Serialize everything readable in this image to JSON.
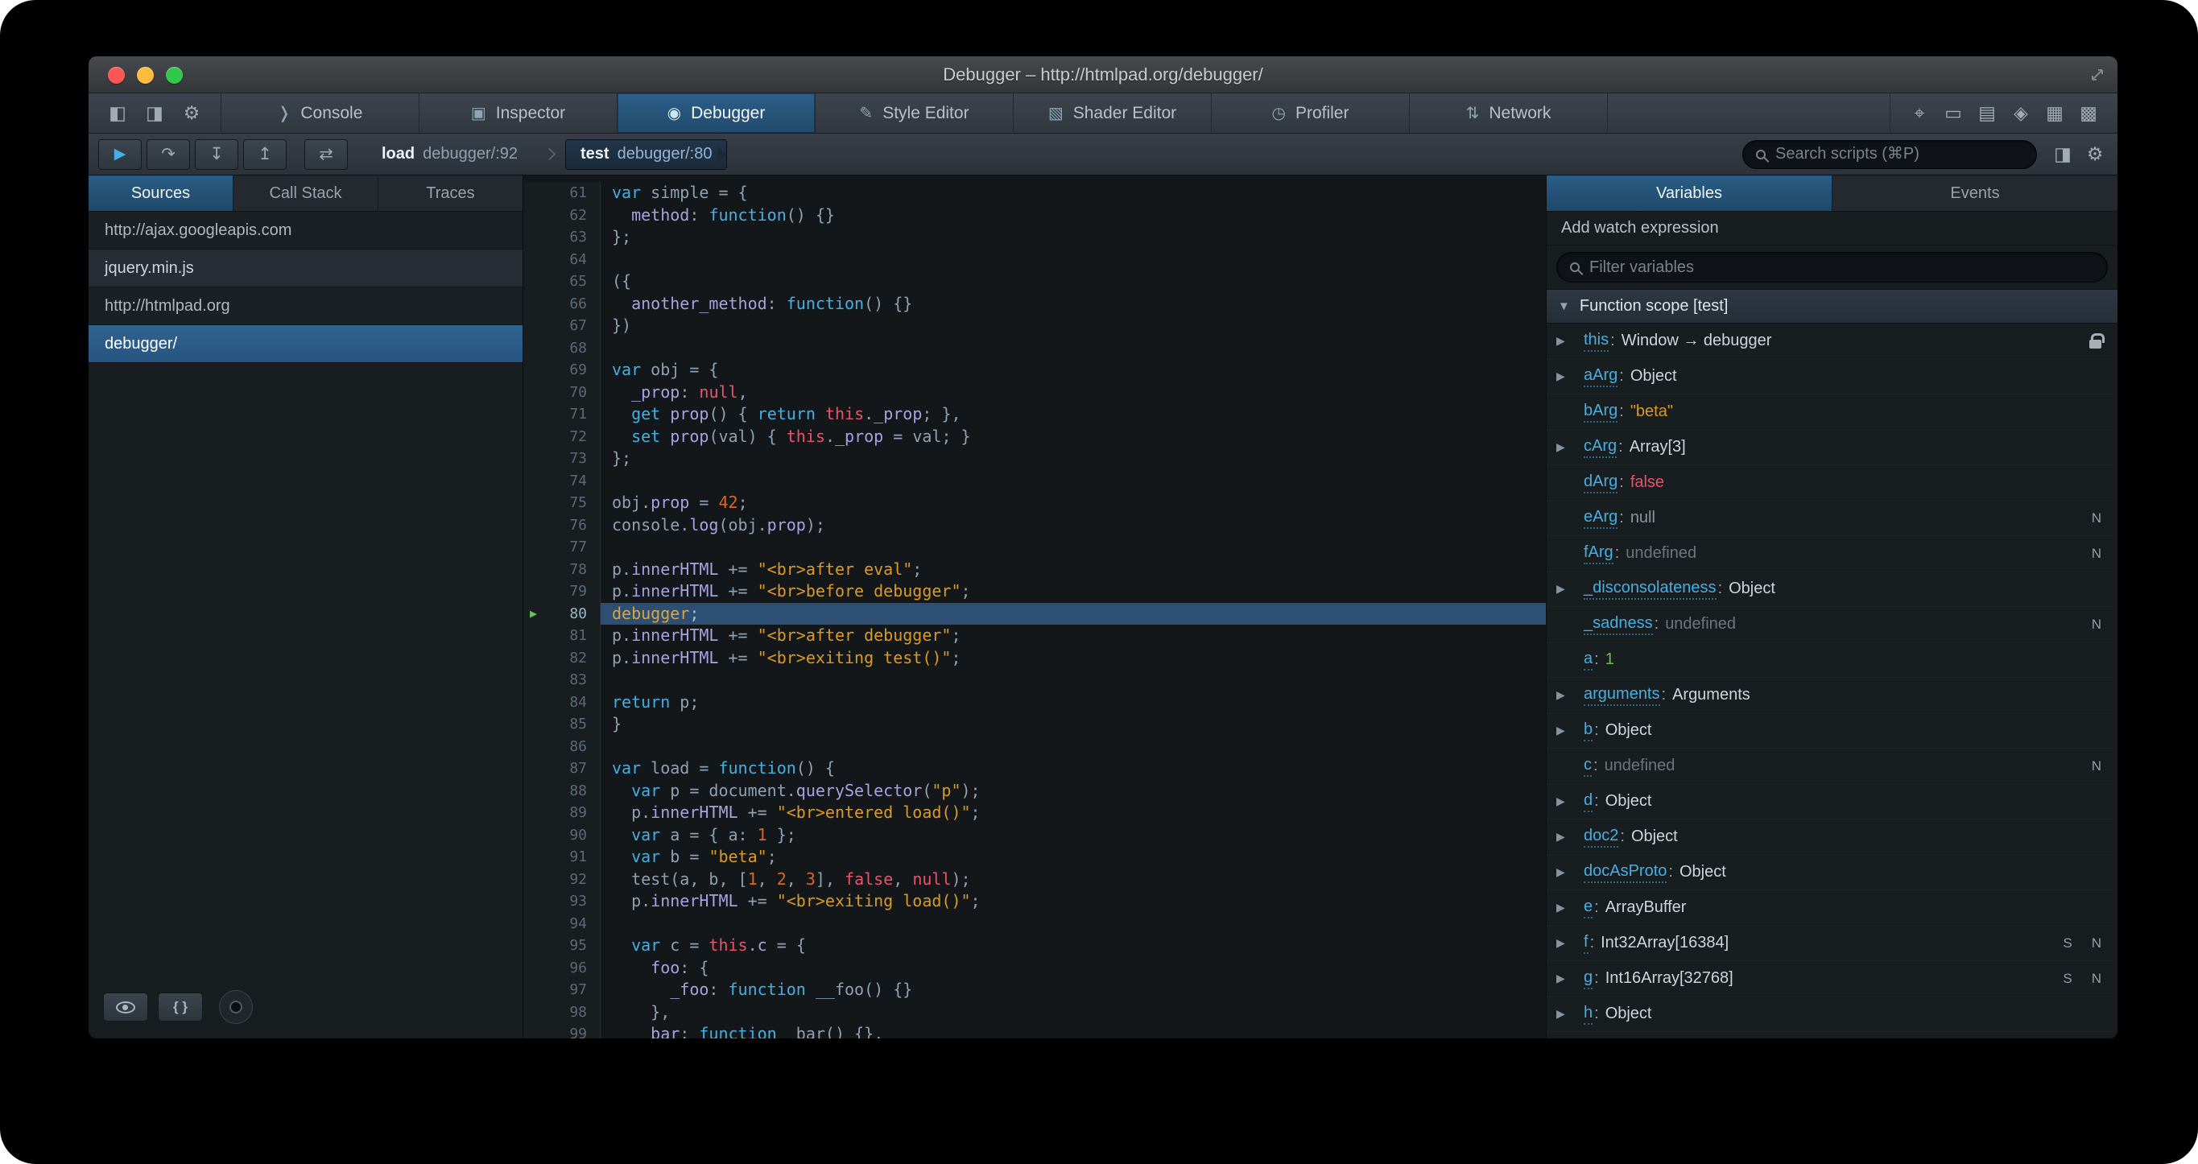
{
  "window": {
    "title": "Debugger – http://htmlpad.org/debugger/"
  },
  "theme": {
    "accent_blue": "#46afe3",
    "selection_blue": "#2d4f74",
    "string_orange": "#d99b28",
    "atom_red": "#eb5368",
    "number_orange": "#d96629",
    "green": "#70bf53",
    "panel_bg": "#181d20"
  },
  "titlebar": {
    "traffic_lights": [
      {
        "name": "close-button",
        "color": "#fc5753"
      },
      {
        "name": "minimize-button",
        "color": "#fdbc40"
      },
      {
        "name": "zoom-button",
        "color": "#34c84a"
      }
    ]
  },
  "toolbar": {
    "left_icons": [
      {
        "name": "dock-mode-icon",
        "glyph": "◧"
      },
      {
        "name": "toggle-split-icon",
        "glyph": "◨"
      },
      {
        "name": "devtools-options-gear-icon",
        "glyph": "⚙"
      }
    ],
    "tabs": [
      {
        "label": "Console",
        "icon": "console-icon",
        "glyph": "❭",
        "active": false
      },
      {
        "label": "Inspector",
        "icon": "inspector-icon",
        "glyph": "▣",
        "active": false
      },
      {
        "label": "Debugger",
        "icon": "debugger-icon",
        "glyph": "◉",
        "active": true
      },
      {
        "label": "Style Editor",
        "icon": "style-editor-icon",
        "glyph": "✎",
        "active": false
      },
      {
        "label": "Shader Editor",
        "icon": "shader-editor-icon",
        "glyph": "▧",
        "active": false
      },
      {
        "label": "Profiler",
        "icon": "profiler-icon",
        "glyph": "◷",
        "active": false
      },
      {
        "label": "Network",
        "icon": "network-icon",
        "glyph": "⇅",
        "active": false
      }
    ],
    "right_icons": [
      {
        "name": "pick-element-icon",
        "glyph": "⌖"
      },
      {
        "name": "split-console-icon",
        "glyph": "▭"
      },
      {
        "name": "responsive-mode-icon",
        "glyph": "▤"
      },
      {
        "name": "paintbrush-icon",
        "glyph": "◈"
      },
      {
        "name": "scratchpad-icon",
        "glyph": "▦"
      },
      {
        "name": "tilt-3d-icon",
        "glyph": "▩"
      }
    ]
  },
  "debug_toolbar": {
    "buttons": [
      {
        "name": "resume-button",
        "glyph": "▶",
        "accent": true
      },
      {
        "name": "step-over-button",
        "glyph": "↷"
      },
      {
        "name": "step-in-button",
        "glyph": "↧"
      },
      {
        "name": "step-out-button",
        "glyph": "↥"
      },
      {
        "name": "pause-on-exceptions-button",
        "glyph": "⇄",
        "gap": true
      }
    ],
    "breadcrumbs": [
      {
        "fn": "load",
        "loc": "debugger/:92",
        "active": false
      },
      {
        "fn": "test",
        "loc": "debugger/:80",
        "active": true
      }
    ],
    "search_placeholder": "Search scripts (⌘P)",
    "right_icons": [
      {
        "name": "toggle-panes-icon",
        "glyph": "◨"
      },
      {
        "name": "debugger-settings-gear-icon",
        "glyph": "⚙"
      }
    ]
  },
  "sources": {
    "tabs": [
      "Sources",
      "Call Stack",
      "Traces"
    ],
    "active_tab": "Sources",
    "items": [
      {
        "label": "http://ajax.googleapis.com",
        "kind": "host",
        "selected": false
      },
      {
        "label": "jquery.min.js",
        "kind": "file",
        "selected": false
      },
      {
        "label": "http://htmlpad.org",
        "kind": "host",
        "selected": false
      },
      {
        "label": "debugger/",
        "kind": "file",
        "selected": true
      }
    ],
    "prettify_glyph": "{ }"
  },
  "editor": {
    "lines": [
      {
        "n": 61,
        "t": [
          [
            "kw",
            "var"
          ],
          [
            "pln",
            " simple = {"
          ]
        ]
      },
      {
        "n": 62,
        "t": [
          [
            "pln",
            "  "
          ],
          [
            "prop",
            "method"
          ],
          [
            "pln",
            ": "
          ],
          [
            "kw",
            "function"
          ],
          [
            "pln",
            "() {}"
          ]
        ]
      },
      {
        "n": 63,
        "t": [
          [
            "pln",
            "};"
          ]
        ]
      },
      {
        "n": 64,
        "t": []
      },
      {
        "n": 65,
        "t": [
          [
            "pln",
            "({"
          ]
        ]
      },
      {
        "n": 66,
        "t": [
          [
            "pln",
            "  "
          ],
          [
            "prop",
            "another_method"
          ],
          [
            "pln",
            ": "
          ],
          [
            "kw",
            "function"
          ],
          [
            "pln",
            "() {}"
          ]
        ]
      },
      {
        "n": 67,
        "t": [
          [
            "pln",
            "})"
          ]
        ]
      },
      {
        "n": 68,
        "t": []
      },
      {
        "n": 69,
        "t": [
          [
            "kw",
            "var"
          ],
          [
            "pln",
            " obj = {"
          ]
        ]
      },
      {
        "n": 70,
        "t": [
          [
            "pln",
            "  "
          ],
          [
            "prop",
            "_prop"
          ],
          [
            "pln",
            ": "
          ],
          [
            "atom",
            "null"
          ],
          [
            "pln",
            ","
          ]
        ]
      },
      {
        "n": 71,
        "t": [
          [
            "pln",
            "  "
          ],
          [
            "kw",
            "get"
          ],
          [
            "pln",
            " "
          ],
          [
            "prop",
            "prop"
          ],
          [
            "pln",
            "() { "
          ],
          [
            "kw",
            "return"
          ],
          [
            "pln",
            " "
          ],
          [
            "ths",
            "this"
          ],
          [
            "pln",
            "."
          ],
          [
            "prop",
            "_prop"
          ],
          [
            "pln",
            "; },"
          ]
        ]
      },
      {
        "n": 72,
        "t": [
          [
            "pln",
            "  "
          ],
          [
            "kw",
            "set"
          ],
          [
            "pln",
            " "
          ],
          [
            "prop",
            "prop"
          ],
          [
            "pln",
            "(val) { "
          ],
          [
            "ths",
            "this"
          ],
          [
            "pln",
            "."
          ],
          [
            "prop",
            "_prop"
          ],
          [
            "pln",
            " = val; }"
          ]
        ]
      },
      {
        "n": 73,
        "t": [
          [
            "pln",
            "};"
          ]
        ]
      },
      {
        "n": 74,
        "t": []
      },
      {
        "n": 75,
        "t": [
          [
            "pln",
            "obj."
          ],
          [
            "prop",
            "prop"
          ],
          [
            "pln",
            " = "
          ],
          [
            "num",
            "42"
          ],
          [
            "pln",
            ";"
          ]
        ]
      },
      {
        "n": 76,
        "t": [
          [
            "pln",
            "console."
          ],
          [
            "prop",
            "log"
          ],
          [
            "pln",
            "(obj."
          ],
          [
            "prop",
            "prop"
          ],
          [
            "pln",
            ");"
          ]
        ]
      },
      {
        "n": 77,
        "t": []
      },
      {
        "n": 78,
        "t": [
          [
            "pln",
            "p."
          ],
          [
            "prop",
            "innerHTML"
          ],
          [
            "pln",
            " += "
          ],
          [
            "str",
            "\"<br>after eval\""
          ],
          [
            "pln",
            ";"
          ]
        ]
      },
      {
        "n": 79,
        "t": [
          [
            "pln",
            "p."
          ],
          [
            "prop",
            "innerHTML"
          ],
          [
            "pln",
            " += "
          ],
          [
            "str",
            "\"<br>before debugger\""
          ],
          [
            "pln",
            ";"
          ]
        ]
      },
      {
        "n": 80,
        "hl": true,
        "t": [
          [
            "dbg",
            "debugger"
          ],
          [
            "pln",
            ";"
          ]
        ]
      },
      {
        "n": 81,
        "t": [
          [
            "pln",
            "p."
          ],
          [
            "prop",
            "innerHTML"
          ],
          [
            "pln",
            " += "
          ],
          [
            "str",
            "\"<br>after debugger\""
          ],
          [
            "pln",
            ";"
          ]
        ]
      },
      {
        "n": 82,
        "t": [
          [
            "pln",
            "p."
          ],
          [
            "prop",
            "innerHTML"
          ],
          [
            "pln",
            " += "
          ],
          [
            "str",
            "\"<br>exiting test()\""
          ],
          [
            "pln",
            ";"
          ]
        ]
      },
      {
        "n": 83,
        "t": []
      },
      {
        "n": 84,
        "t": [
          [
            "kw",
            "return"
          ],
          [
            "pln",
            " p;"
          ]
        ]
      },
      {
        "n": 85,
        "t": [
          [
            "pln",
            "}"
          ]
        ]
      },
      {
        "n": 86,
        "t": []
      },
      {
        "n": 87,
        "t": [
          [
            "kw",
            "var"
          ],
          [
            "pln",
            " load = "
          ],
          [
            "kw",
            "function"
          ],
          [
            "pln",
            "() {"
          ]
        ]
      },
      {
        "n": 88,
        "t": [
          [
            "pln",
            "  "
          ],
          [
            "kw",
            "var"
          ],
          [
            "pln",
            " p = document."
          ],
          [
            "prop",
            "querySelector"
          ],
          [
            "pln",
            "("
          ],
          [
            "str",
            "\"p\""
          ],
          [
            "pln",
            ");"
          ]
        ]
      },
      {
        "n": 89,
        "t": [
          [
            "pln",
            "  p."
          ],
          [
            "prop",
            "innerHTML"
          ],
          [
            "pln",
            " += "
          ],
          [
            "str",
            "\"<br>entered load()\""
          ],
          [
            "pln",
            ";"
          ]
        ]
      },
      {
        "n": 90,
        "t": [
          [
            "pln",
            "  "
          ],
          [
            "kw",
            "var"
          ],
          [
            "pln",
            " a = { a: "
          ],
          [
            "num",
            "1"
          ],
          [
            "pln",
            " };"
          ]
        ]
      },
      {
        "n": 91,
        "t": [
          [
            "pln",
            "  "
          ],
          [
            "kw",
            "var"
          ],
          [
            "pln",
            " b = "
          ],
          [
            "str",
            "\"beta\""
          ],
          [
            "pln",
            ";"
          ]
        ]
      },
      {
        "n": 92,
        "t": [
          [
            "pln",
            "  test(a, b, ["
          ],
          [
            "num",
            "1"
          ],
          [
            "pln",
            ", "
          ],
          [
            "num",
            "2"
          ],
          [
            "pln",
            ", "
          ],
          [
            "num",
            "3"
          ],
          [
            "pln",
            "], "
          ],
          [
            "atom",
            "false"
          ],
          [
            "pln",
            ", "
          ],
          [
            "atom",
            "null"
          ],
          [
            "pln",
            ");"
          ]
        ]
      },
      {
        "n": 93,
        "t": [
          [
            "pln",
            "  p."
          ],
          [
            "prop",
            "innerHTML"
          ],
          [
            "pln",
            " += "
          ],
          [
            "str",
            "\"<br>exiting load()\""
          ],
          [
            "pln",
            ";"
          ]
        ]
      },
      {
        "n": 94,
        "t": []
      },
      {
        "n": 95,
        "t": [
          [
            "pln",
            "  "
          ],
          [
            "kw",
            "var"
          ],
          [
            "pln",
            " c = "
          ],
          [
            "ths",
            "this"
          ],
          [
            "pln",
            "."
          ],
          [
            "prop",
            "c"
          ],
          [
            "pln",
            " = {"
          ]
        ]
      },
      {
        "n": 96,
        "t": [
          [
            "pln",
            "    "
          ],
          [
            "prop",
            "foo"
          ],
          [
            "pln",
            ": {"
          ]
        ]
      },
      {
        "n": 97,
        "t": [
          [
            "pln",
            "      "
          ],
          [
            "prop",
            "_foo"
          ],
          [
            "pln",
            ": "
          ],
          [
            "kw",
            "function"
          ],
          [
            "pln",
            " __foo() {}"
          ]
        ]
      },
      {
        "n": 98,
        "t": [
          [
            "pln",
            "    },"
          ]
        ]
      },
      {
        "n": 99,
        "t": [
          [
            "pln",
            "    "
          ],
          [
            "prop",
            "bar"
          ],
          [
            "pln",
            ": "
          ],
          [
            "kw",
            "function"
          ],
          [
            "pln",
            " _bar() {},"
          ]
        ]
      }
    ]
  },
  "variables": {
    "tabs": [
      "Variables",
      "Events"
    ],
    "active_tab": "Variables",
    "watch_label": "Add watch expression",
    "filter_placeholder": "Filter variables",
    "scope": "Function scope [test]",
    "items": [
      {
        "name": "this",
        "value": "Window → debugger",
        "type": "obj",
        "expand": true,
        "lock": true
      },
      {
        "name": "aArg",
        "value": "Object",
        "type": "obj",
        "expand": true
      },
      {
        "name": "bArg",
        "value": "\"beta\"",
        "type": "str"
      },
      {
        "name": "cArg",
        "value": "Array[3]",
        "type": "obj",
        "expand": true
      },
      {
        "name": "dArg",
        "value": "false",
        "type": "bool"
      },
      {
        "name": "eArg",
        "value": "null",
        "type": "null",
        "badges": [
          "N"
        ]
      },
      {
        "name": "fArg",
        "value": "undefined",
        "type": "undef",
        "badges": [
          "N"
        ]
      },
      {
        "name": "_disconsolateness",
        "value": "Object",
        "type": "obj",
        "expand": true
      },
      {
        "name": "_sadness",
        "value": "undefined",
        "type": "undef",
        "badges": [
          "N"
        ]
      },
      {
        "name": "a",
        "value": "1",
        "type": "num"
      },
      {
        "name": "arguments",
        "value": "Arguments",
        "type": "obj",
        "expand": true
      },
      {
        "name": "b",
        "value": "Object",
        "type": "obj",
        "expand": true
      },
      {
        "name": "c",
        "value": "undefined",
        "type": "undef",
        "badges": [
          "N"
        ]
      },
      {
        "name": "d",
        "value": "Object",
        "type": "obj",
        "expand": true
      },
      {
        "name": "doc2",
        "value": "Object",
        "type": "obj",
        "expand": true
      },
      {
        "name": "docAsProto",
        "value": "Object",
        "type": "obj",
        "expand": true
      },
      {
        "name": "e",
        "value": "ArrayBuffer",
        "type": "obj",
        "expand": true
      },
      {
        "name": "f",
        "value": "Int32Array[16384]",
        "type": "obj",
        "expand": true,
        "badges": [
          "S",
          "N"
        ]
      },
      {
        "name": "g",
        "value": "Int16Array[32768]",
        "type": "obj",
        "expand": true,
        "badges": [
          "S",
          "N"
        ]
      },
      {
        "name": "h",
        "value": "Object",
        "type": "obj",
        "expand": true
      }
    ]
  }
}
